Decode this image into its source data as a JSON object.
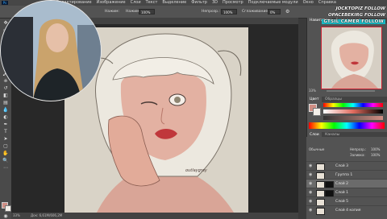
{
  "menubar": {
    "app_badge": "Ps",
    "items": [
      "Редактирование",
      "Изображение",
      "Слои",
      "Текст",
      "Выделение",
      "Фильтр",
      "3D",
      "Просмотр",
      "Подключаемые модули",
      "Окно",
      "Справка"
    ]
  },
  "options": {
    "mode_label": "Нажим:",
    "opacity_label": "Непрозр.:",
    "opacity_value": "100%",
    "flow_label": "Нажим:",
    "flow_value": "100%",
    "smooth_label": "Сглаживание:",
    "smooth_value": "0%"
  },
  "canvas": {
    "signature": "outlaygrey"
  },
  "status": {
    "zoom": "33%",
    "doc_info": "Док: 6,61М/606,2М"
  },
  "panels": {
    "top_tabs": [
      "Навигатор",
      "Гистограмма"
    ],
    "zoom_value": "33%",
    "color_tabs": [
      "Цвет",
      "Образцы"
    ],
    "layers_tabs": [
      "Слои",
      "Каналы"
    ],
    "blend_mode": "Обычные",
    "opacity_label": "Непрозр.:",
    "opacity_value": "100%",
    "fill_label": "Заливка:",
    "fill_value": "100%",
    "layers": [
      {
        "name": "Слой 3",
        "selected": false,
        "has_mask": false
      },
      {
        "name": "Группа 1",
        "selected": false,
        "has_mask": false
      },
      {
        "name": "Слой 2",
        "selected": true,
        "has_mask": true
      },
      {
        "name": "Слой 1",
        "selected": false,
        "has_mask": true
      },
      {
        "name": "Слой 5",
        "selected": false,
        "has_mask": false
      },
      {
        "name": "Слой 4 копия",
        "selected": false,
        "has_mask": false
      }
    ]
  },
  "overlays": {
    "line1": "JOCKTOPIZ FOLLOW",
    "line2": "OPACEBEKIRG FOLLOW",
    "line3": "GTSIL CAMER FOLLOW"
  },
  "colors": {
    "foreground": "#d08e84",
    "background": "#f4efe9",
    "accent": "#18b9c4"
  }
}
